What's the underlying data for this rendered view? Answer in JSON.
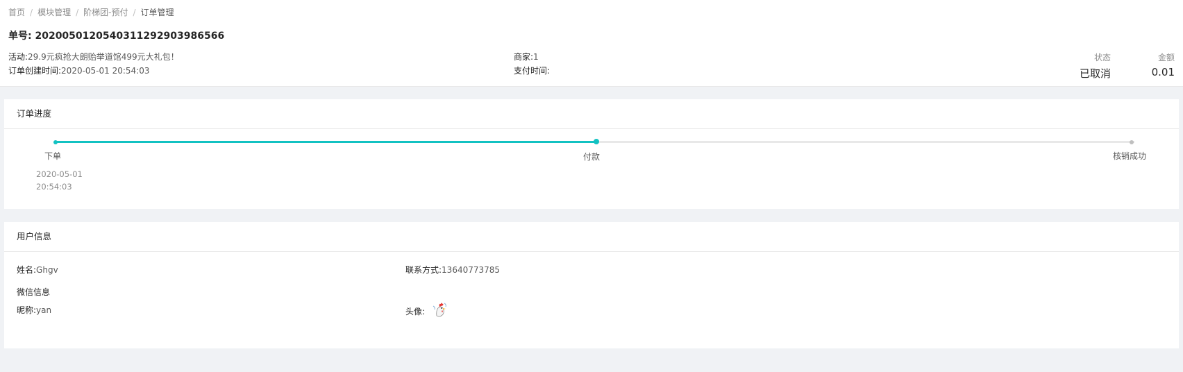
{
  "breadcrumb": [
    "首页",
    "模块管理",
    "阶梯团-预付",
    "订单管理"
  ],
  "order": {
    "title": "单号: 20200501205403112929039865​66",
    "activity_label": "活动:",
    "activity_value": "29.9元疯抢大朗贻举道馆499元大礼包！",
    "created_label": "订单创建时间:",
    "created_value": "2020-05-01 20:54:03",
    "merchant_label": "商家:",
    "merchant_value": "1",
    "paid_label": "支付时间:",
    "paid_value": "",
    "status_label": "状态",
    "status_value": "已取消",
    "amount_label": "金额",
    "amount_value": "0.01"
  },
  "progress": {
    "title": "订单进度",
    "steps": [
      {
        "label": "下单",
        "date": "2020-05-01",
        "time": "20:54:03",
        "state": "done"
      },
      {
        "label": "付款",
        "date": "",
        "time": "",
        "state": "current"
      },
      {
        "label": "核销成功",
        "date": "",
        "time": "",
        "state": "pending"
      }
    ],
    "colors": {
      "active": "#13c2c2",
      "pending": "#e8e8e8"
    }
  },
  "user": {
    "title": "用户信息",
    "name_label": "姓名:",
    "name_value": "Ghgv",
    "contact_label": "联系方式:",
    "contact_value": "13640773785",
    "wechat_title": "微信信息",
    "nickname_label": "昵称:",
    "nickname_value": "yan",
    "avatar_label": "头像:",
    "avatar_icon": "rooster-avatar-icon"
  }
}
